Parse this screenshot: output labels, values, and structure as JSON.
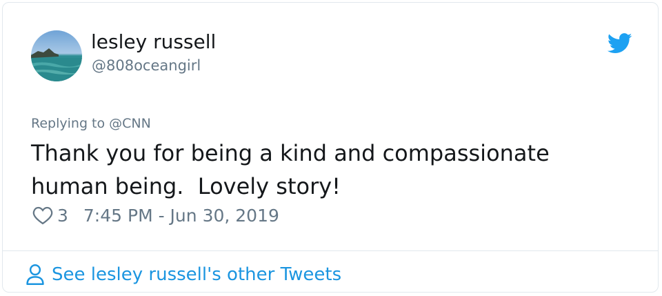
{
  "user": {
    "name": "lesley russell",
    "handle": "@808oceangirl"
  },
  "reply": {
    "prefix": "Replying to ",
    "mention": "@CNN"
  },
  "tweet": {
    "text": "Thank you for being a kind and compassionate\nhuman being.  Lovely story!"
  },
  "meta": {
    "likes": "3",
    "timestamp": "7:45 PM - Jun 30, 2019"
  },
  "footer": {
    "link_label": "See lesley russell's other Tweets"
  },
  "icons": {
    "brand": "twitter-bird-icon",
    "like": "heart-icon",
    "profile": "person-icon"
  },
  "colors": {
    "brand": "#1da1f2",
    "link": "#1b95e0",
    "text": "#14171a",
    "muted": "#657786"
  }
}
